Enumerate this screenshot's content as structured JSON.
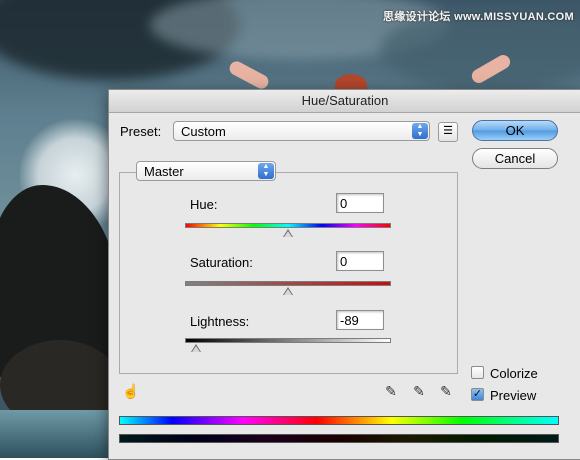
{
  "watermark": "思缘设计论坛 www.MISSYUAN.COM",
  "dialog": {
    "title": "Hue/Saturation",
    "preset_label": "Preset:",
    "preset_value": "Custom",
    "ok_label": "OK",
    "cancel_label": "Cancel",
    "channel_value": "Master",
    "hue_label": "Hue:",
    "hue_value": "0",
    "saturation_label": "Saturation:",
    "saturation_value": "0",
    "lightness_label": "Lightness:",
    "lightness_value": "-89",
    "colorize_label": "Colorize",
    "colorize_checked": false,
    "preview_label": "Preview",
    "preview_checked": true
  },
  "icons": {
    "preset_menu": "list-menu-icon",
    "hand_tool": "hand-adjust-icon",
    "eyedropper": "eyedropper-icon",
    "eyedropper_plus": "eyedropper-plus-icon",
    "eyedropper_minus": "eyedropper-minus-icon"
  },
  "colors": {
    "default_button": "#6eaee9",
    "dialog_bg": "#e8e8e8"
  }
}
